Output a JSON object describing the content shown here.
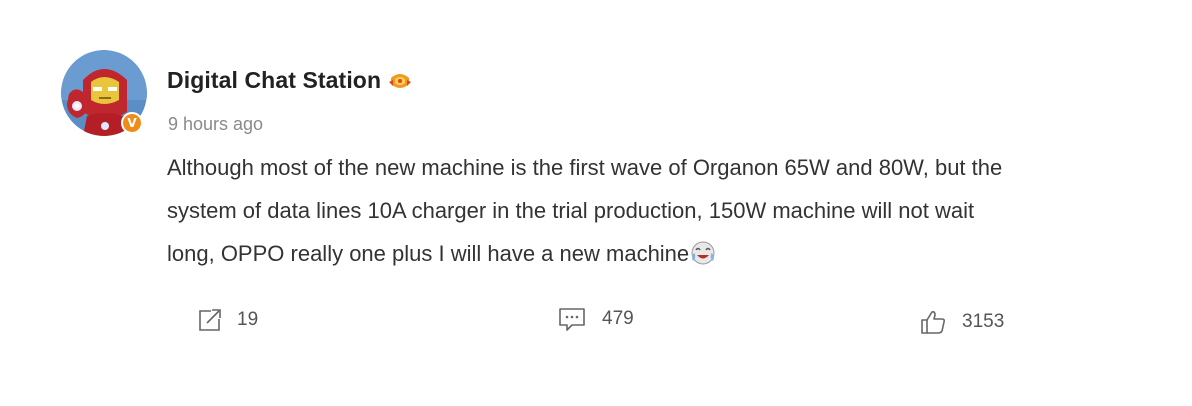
{
  "post": {
    "author": "Digital Chat Station",
    "time": "9 hours ago",
    "verified_mark": "V",
    "text_lines": [
      "Although most of the new machine is the first wave of Organon 65W and 80W, but the",
      "system of data lines 10A charger in the trial production, 150W machine will not wait",
      "long, OPPO really one plus I will have a new machine"
    ],
    "icons": {
      "avatar": "iron-man-avatar",
      "badge": "fan-badge-icon",
      "emoji": "laughing-crying-emoji-icon",
      "repost": "repost-icon",
      "comment": "comment-icon",
      "like": "thumbs-up-icon"
    }
  },
  "actions": {
    "repost_count": "19",
    "comment_count": "479",
    "like_count": "3153"
  },
  "colors": {
    "verified": "#f08b16",
    "name": "#222222",
    "time": "#8a8a8a",
    "text": "#333333"
  }
}
